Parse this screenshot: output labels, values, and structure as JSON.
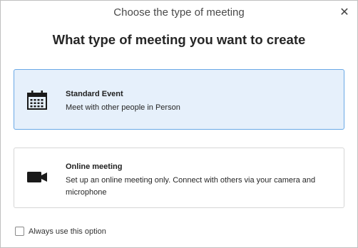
{
  "dialog": {
    "title": "Choose the type of meeting",
    "close_glyph": "✕",
    "heading": "What type of meeting you want to create"
  },
  "options": [
    {
      "icon": "calendar-icon",
      "title": "Standard Event",
      "description": "Meet with other people in Person",
      "selected": true
    },
    {
      "icon": "video-camera-icon",
      "title": "Online meeting",
      "description": "Set up an online meeting only. Connect with others via your camera and microphone",
      "selected": false
    }
  ],
  "footer": {
    "checkbox_label": "Always use this option",
    "checked": false
  },
  "colors": {
    "selected_bg": "#e6f0fb",
    "selected_border": "#6aa9e6"
  }
}
